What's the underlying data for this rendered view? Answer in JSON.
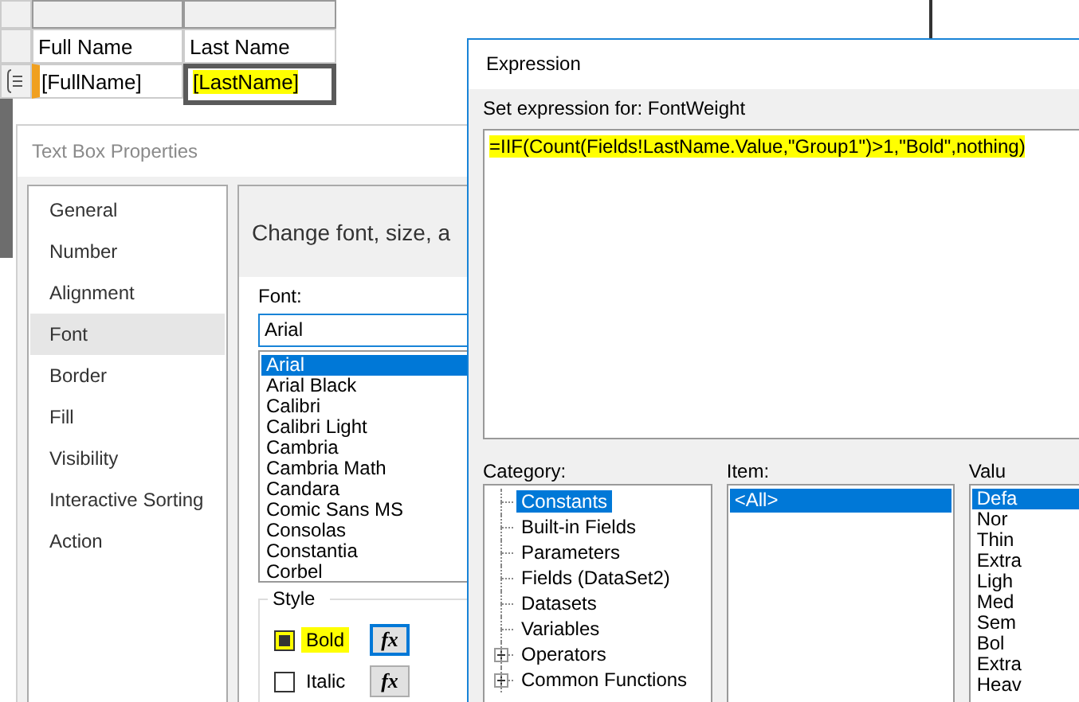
{
  "report_table": {
    "header_row": [
      "Full Name",
      "Last Name"
    ],
    "data_row": [
      {
        "text": "[FullName]",
        "highlighted": false,
        "selected": false
      },
      {
        "text": "[LastName]",
        "highlighted": true,
        "selected": true
      }
    ]
  },
  "text_box_properties": {
    "title": "Text Box Properties",
    "nav": [
      {
        "label": "General",
        "selected": false
      },
      {
        "label": "Number",
        "selected": false
      },
      {
        "label": "Alignment",
        "selected": false
      },
      {
        "label": "Font",
        "selected": true
      },
      {
        "label": "Border",
        "selected": false
      },
      {
        "label": "Fill",
        "selected": false
      },
      {
        "label": "Visibility",
        "selected": false
      },
      {
        "label": "Interactive Sorting",
        "selected": false
      },
      {
        "label": "Action",
        "selected": false
      }
    ],
    "heading": "Change font, size, a",
    "font_label": "Font:",
    "font_value": "Arial",
    "fonts": [
      {
        "label": "Arial",
        "selected": true
      },
      {
        "label": "Arial Black",
        "selected": false
      },
      {
        "label": "Calibri",
        "selected": false
      },
      {
        "label": "Calibri Light",
        "selected": false
      },
      {
        "label": "Cambria",
        "selected": false
      },
      {
        "label": "Cambria Math",
        "selected": false
      },
      {
        "label": "Candara",
        "selected": false
      },
      {
        "label": "Comic Sans MS",
        "selected": false
      },
      {
        "label": "Consolas",
        "selected": false
      },
      {
        "label": "Constantia",
        "selected": false
      },
      {
        "label": "Corbel",
        "selected": false
      }
    ],
    "style_label": "Style",
    "styles": [
      {
        "label": "Bold",
        "checked": true,
        "highlighted": true,
        "button": "fx",
        "focused": true
      },
      {
        "label": "Italic",
        "checked": false,
        "highlighted": false,
        "button": "fx",
        "focused": false
      }
    ]
  },
  "expression": {
    "title": "Expression",
    "prompt": "Set expression for: FontWeight",
    "value": "=IIF(Count(Fields!LastName.Value,\"Group1\")>1,\"Bold\",nothing)",
    "highlighted": true,
    "category_label": "Category:",
    "categories": [
      {
        "label": "Constants",
        "selected": true,
        "expandable": false
      },
      {
        "label": "Built-in Fields",
        "selected": false,
        "expandable": false
      },
      {
        "label": "Parameters",
        "selected": false,
        "expandable": false
      },
      {
        "label": "Fields (DataSet2)",
        "selected": false,
        "expandable": false
      },
      {
        "label": "Datasets",
        "selected": false,
        "expandable": false
      },
      {
        "label": "Variables",
        "selected": false,
        "expandable": false
      },
      {
        "label": "Operators",
        "selected": false,
        "expandable": true
      },
      {
        "label": "Common Functions",
        "selected": false,
        "expandable": true
      }
    ],
    "item_label": "Item:",
    "items": [
      {
        "label": "<All>",
        "selected": true
      }
    ],
    "value_label": "Valu",
    "values": [
      {
        "label": "Defa",
        "selected": true
      },
      {
        "label": "Nor",
        "selected": false
      },
      {
        "label": "Thin",
        "selected": false
      },
      {
        "label": "Extra",
        "selected": false
      },
      {
        "label": "Ligh",
        "selected": false
      },
      {
        "label": "Med",
        "selected": false
      },
      {
        "label": "Sem",
        "selected": false
      },
      {
        "label": "Bol",
        "selected": false
      },
      {
        "label": "Extra",
        "selected": false
      },
      {
        "label": "Heav",
        "selected": false
      }
    ]
  }
}
